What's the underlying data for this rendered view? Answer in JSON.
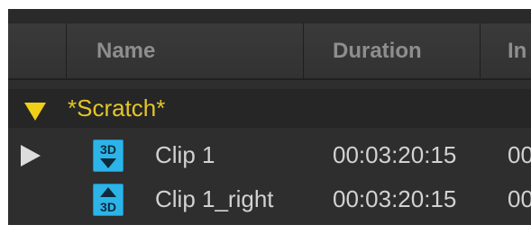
{
  "columns": {
    "name": "Name",
    "duration": "Duration",
    "in": "In"
  },
  "group": {
    "name": "*Scratch*",
    "expanded": true
  },
  "clips": [
    {
      "name": "Clip 1",
      "duration": "00:03:20:15",
      "in": "00",
      "icon": "3d-left-eye-icon",
      "icon_label": "3D",
      "playing_indicator": true
    },
    {
      "name": "Clip 1_right",
      "duration": "00:03:20:15",
      "in": "00",
      "icon": "3d-right-eye-icon",
      "icon_label": "3D",
      "playing_indicator": false
    }
  ],
  "colors": {
    "group_text": "#e3c629",
    "icon_bg": "#2cb4e8",
    "header_text": "#8e8e8e",
    "row_text": "#d2d2d2"
  }
}
